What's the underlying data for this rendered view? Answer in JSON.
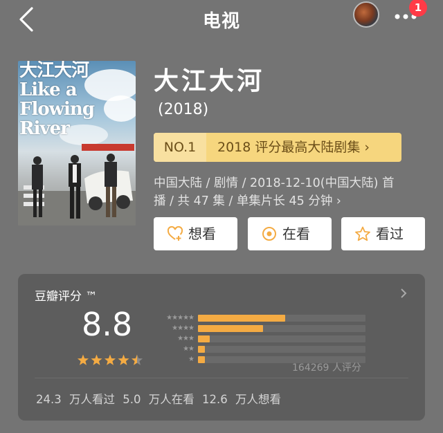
{
  "nav": {
    "title": "电视",
    "notification_count": "1"
  },
  "poster": {
    "text": "大江大河 Like a Flowing River"
  },
  "show": {
    "title": "大江大河",
    "year": "(2018)",
    "rank_no": "NO.1",
    "rank_text": "2018 评分最高大陆剧集 ›",
    "meta_line1": "中国大陆 / 剧情 / 2018-12-10(中国大陆) 首",
    "meta_line2": "播 / 共 47 集 / 单集片长 45 分钟 ›"
  },
  "actions": [
    {
      "label": "想看",
      "icon": "heart-plus-icon"
    },
    {
      "label": "在看",
      "icon": "target-circle-icon"
    },
    {
      "label": "看过",
      "icon": "star-outline-icon"
    }
  ],
  "rating": {
    "label": "豆瓣评分 ™",
    "score": "8.8",
    "stars_value": 4.5,
    "rating_count": "164269 人评分",
    "distribution": [
      {
        "stars": "★★★★★",
        "fraction": 0.52
      },
      {
        "stars": "★★★★",
        "fraction": 0.39
      },
      {
        "stars": "★★★",
        "fraction": 0.07
      },
      {
        "stars": "★★",
        "fraction": 0.04
      },
      {
        "stars": "★",
        "fraction": 0.04
      }
    ],
    "stats": "24.3 万人看过  5.0 万人在看  12.6 万人想看"
  },
  "colors": {
    "accent": "#f4ab43",
    "badge": "#ff3b47",
    "rank_bg": "#f6d67e"
  }
}
